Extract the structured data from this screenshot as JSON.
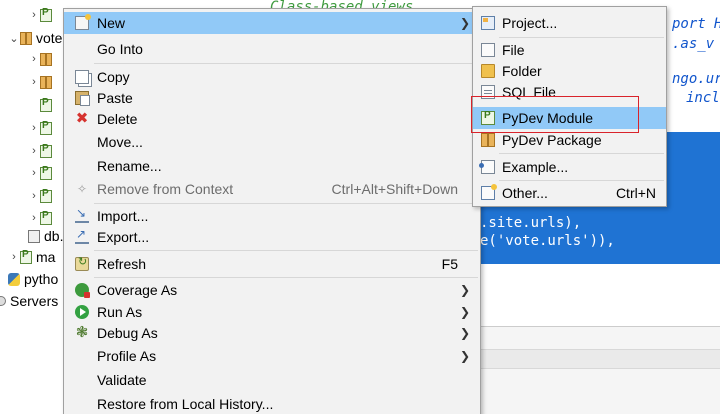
{
  "explorer": {
    "items": [
      {
        "label": "",
        "icon": "python-file-icon"
      },
      {
        "label": "vote",
        "icon": "package-icon"
      },
      {
        "label": "",
        "icon": "package-icon"
      },
      {
        "label": "",
        "icon": "package-icon"
      },
      {
        "label": "",
        "icon": "python-file-icon"
      },
      {
        "label": "",
        "icon": "python-file-icon"
      },
      {
        "label": "",
        "icon": "python-file-icon"
      },
      {
        "label": "",
        "icon": "python-file-icon"
      },
      {
        "label": "",
        "icon": "python-file-icon"
      },
      {
        "label": "",
        "icon": "python-file-icon"
      },
      {
        "label": "db.",
        "icon": "database-file-icon"
      },
      {
        "label": "ma",
        "icon": "python-file-icon"
      },
      {
        "label": "pytho",
        "icon": "python-icon"
      },
      {
        "label": "Servers",
        "icon": "server-icon"
      }
    ]
  },
  "editor": {
    "lines": [
      {
        "text": "Class-based views",
        "style": "green"
      },
      {
        "text": "port H",
        "style": "blue"
      },
      {
        "text": ".as_v",
        "style": "blue"
      },
      {
        "text": "ngo.ur",
        "style": "blue"
      },
      {
        "text": "incl",
        "style": "blue"
      },
      {
        "text": ".site.urls),",
        "style": "white"
      },
      {
        "text": "e('vote.urls')),",
        "style": "white"
      }
    ],
    "selection_color": "#1f73d3"
  },
  "context_menu": {
    "items": [
      {
        "label": "New",
        "icon": "new-icon",
        "submenu": true,
        "highlighted": true
      },
      {
        "label": "Go Into",
        "icon": ""
      },
      {
        "label": "Copy",
        "icon": "copy-icon"
      },
      {
        "label": "Paste",
        "icon": "paste-icon"
      },
      {
        "label": "Delete",
        "icon": "delete-icon"
      },
      {
        "label": "Move...",
        "icon": ""
      },
      {
        "label": "Rename...",
        "icon": ""
      },
      {
        "label": "Remove from Context",
        "icon": "remove-context-icon",
        "shortcut": "Ctrl+Alt+Shift+Down",
        "disabled": true
      },
      {
        "label": "Import...",
        "icon": "import-icon"
      },
      {
        "label": "Export...",
        "icon": "export-icon"
      },
      {
        "label": "Refresh",
        "icon": "refresh-icon",
        "shortcut": "F5"
      },
      {
        "label": "Coverage As",
        "icon": "coverage-icon",
        "submenu": true
      },
      {
        "label": "Run As",
        "icon": "run-icon",
        "submenu": true
      },
      {
        "label": "Debug As",
        "icon": "debug-icon",
        "submenu": true
      },
      {
        "label": "Profile As",
        "icon": "",
        "submenu": true
      },
      {
        "label": "Validate",
        "icon": ""
      },
      {
        "label": "Restore from Local History...",
        "icon": ""
      }
    ],
    "highlight_color": "#91c9f7"
  },
  "new_submenu": {
    "items": [
      {
        "label": "Project...",
        "icon": "project-icon"
      },
      {
        "label": "File",
        "icon": "file-icon"
      },
      {
        "label": "Folder",
        "icon": "folder-icon"
      },
      {
        "label": "SQL File",
        "icon": "sql-file-icon"
      },
      {
        "label": "PyDev Module",
        "icon": "pydev-module-icon",
        "highlighted": true
      },
      {
        "label": "PyDev Package",
        "icon": "pydev-package-icon"
      },
      {
        "label": "Example...",
        "icon": "example-icon"
      },
      {
        "label": "Other...",
        "icon": "other-icon",
        "shortcut": "Ctrl+N"
      }
    ],
    "focus_box_color": "#d9232b"
  }
}
